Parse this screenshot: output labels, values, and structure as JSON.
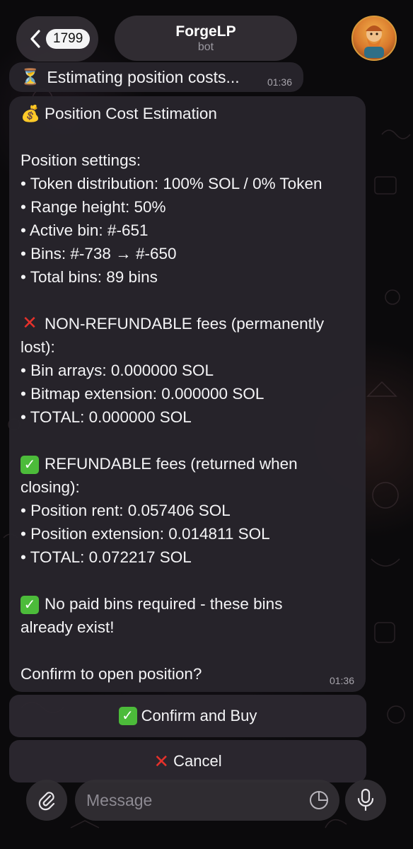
{
  "header": {
    "back_count": "1799",
    "chat_name": "ForgeLP",
    "chat_subtitle": "bot"
  },
  "messages": {
    "status": {
      "icon": "hourglass-icon",
      "text": "Estimating position costs...",
      "time": "01:36"
    },
    "main": {
      "time": "01:36",
      "lines": {
        "title": "Position Cost Estimation",
        "settings_header": "Position settings:",
        "token_distribution": "• Token distribution: 100% SOL / 0% Token",
        "range_height": "• Range height: 50%",
        "active_bin": "• Active bin: #-651",
        "bins": "• Bins: #-738 → #-650",
        "total_bins": "• Total bins: 89 bins",
        "nonrefund_header_1": "NON-REFUNDABLE fees (permanently",
        "nonrefund_header_2": "lost):",
        "bin_arrays": "• Bin arrays: 0.000000 SOL",
        "bitmap_extension": "• Bitmap extension: 0.000000 SOL",
        "nonrefund_total": "• TOTAL: 0.000000 SOL",
        "refund_header_1": "REFUNDABLE fees (returned when",
        "refund_header_2": "closing):",
        "position_rent": "• Position rent: 0.057406 SOL",
        "position_extension": "• Position extension: 0.014811 SOL",
        "refund_total": "• TOTAL: 0.072217 SOL",
        "paid_bins_1": "No paid bins required - these bins",
        "paid_bins_2": "already exist!",
        "confirm_question": "Confirm to open position?"
      },
      "icons": [
        "money-bag-icon",
        "cross-mark-icon",
        "check-mark-icon",
        "check-mark-icon"
      ]
    }
  },
  "keyboard": {
    "confirm_label": "Confirm and Buy",
    "cancel_label": "Cancel"
  },
  "composer": {
    "placeholder": "Message"
  },
  "colors": {
    "check_green": "#4cbb3a",
    "cross_red": "#e5312b",
    "bubble_bg": "#28242c"
  }
}
